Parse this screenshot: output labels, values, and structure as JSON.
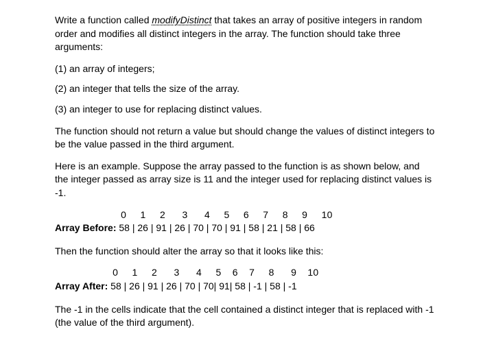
{
  "intro_pre": "Write a function called ",
  "fn_name": "modifyDistinct",
  "intro_post": " that takes an array of positive integers in random order and modifies all distinct integers in the array. The function should take three arguments:",
  "args": [
    "(1) an array of integers;",
    "(2) an integer that tells the size of the array.",
    "(3) an integer to use for replacing distinct values."
  ],
  "desc": "The function should not return a value but should change the values of distinct integers to be the value passed in the third argument.",
  "example_intro": "Here is an example. Suppose the array passed to the function is as shown below, and the integer passed as array size is 11 and the integer used for replacing distinct values is -1.",
  "before": {
    "idx": " 0     1     2      3      4     5     6     7     8     9     10",
    "label": "Array Before:",
    "vals": " 58 | 26 | 91 | 26 | 70 | 70 | 91 | 58 | 21 | 58 | 66"
  },
  "then": "Then the function should alter the array so that it looks like this:",
  "after": {
    "idx": " 0     1     2      3      4     5    6    7     8      9    10",
    "label": "Array After:",
    "vals": " 58 | 26 | 91 | 26 | 70 | 70| 91| 58 | -1 | 58 | -1"
  },
  "closing": "The -1 in the cells indicate that the cell contained a distinct integer that is replaced with -1 (the value of the third argument)."
}
